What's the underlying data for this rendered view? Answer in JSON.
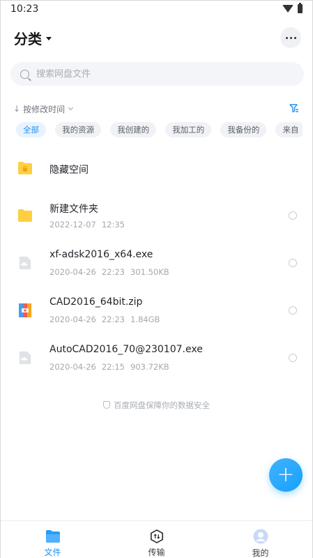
{
  "status_bar": {
    "time": "10:23"
  },
  "header": {
    "title": "分类"
  },
  "search": {
    "placeholder": "搜索网盘文件"
  },
  "sort": {
    "label": "按修改时间"
  },
  "chips": [
    "全部",
    "我的资源",
    "我创建的",
    "我加工的",
    "我备份的",
    "来自"
  ],
  "files": [
    {
      "name": "隐藏空间",
      "date": "",
      "time": "",
      "size": "",
      "icon": "lock-folder-icon"
    },
    {
      "name": "新建文件夹",
      "date": "2022-12-07",
      "time": "12:35",
      "size": "",
      "icon": "folder-icon"
    },
    {
      "name": "xf-adsk2016_x64.exe",
      "date": "2020-04-26",
      "time": "22:23",
      "size": "301.50KB",
      "icon": "cloud-file-icon"
    },
    {
      "name": "CAD2016_64bit.zip",
      "date": "2020-04-26",
      "time": "22:23",
      "size": "1.84GB",
      "icon": "zip-icon"
    },
    {
      "name": "AutoCAD2016_70@230107.exe",
      "date": "2020-04-26",
      "time": "22:15",
      "size": "903.72KB",
      "icon": "cloud-file-icon"
    }
  ],
  "safety_note": "百度网盘保障你的数据安全",
  "bottom_nav": [
    {
      "label": "文件",
      "icon": "folder-icon",
      "active": true
    },
    {
      "label": "传输",
      "icon": "transfer-icon",
      "active": false
    },
    {
      "label": "我的",
      "icon": "avatar-icon",
      "active": false
    }
  ],
  "colors": {
    "accent": "#1f8ff0",
    "folder": "#ffcf3f",
    "fab": "#18a0fb"
  }
}
